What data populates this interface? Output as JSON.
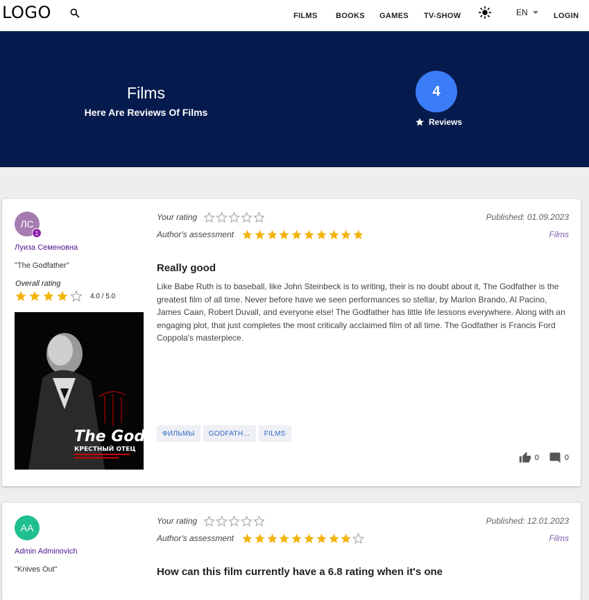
{
  "header": {
    "logo": "LOGO",
    "nav": {
      "films": "FILMS",
      "books": "BOOKS",
      "games": "GAMES",
      "tvshow": "TV-SHOW"
    },
    "language": "EN",
    "login": "LOGIN"
  },
  "hero": {
    "title": "Films",
    "subtitle": "Here Are Reviews Of Films",
    "count": "4",
    "count_label": "Reviews"
  },
  "colors": {
    "hero_bg": "#061b4d",
    "accent": "#3b7cf7",
    "star": "#f5b20a"
  },
  "reviews": [
    {
      "avatar_initials": "ЛС",
      "avatar_color": "#a57cb0",
      "badge": "1",
      "author": "Луиза Семеновна",
      "work": "\"The Godfather\"",
      "overall_label": "Overall rating",
      "overall_value": "4.0 / 5.0",
      "overall_stars": 4,
      "your_rating_label": "Your rating",
      "your_rating": 0,
      "author_assessment_label": "Author's assessment",
      "author_assessment": 10,
      "published": "Published: 01.09.2023",
      "category": "Films",
      "title": "Really good",
      "text": "Like Babe Ruth is to baseball, like John Steinbeck is to writing, their is no doubt about it, The Godfather is the greatest film of all time. Never before have we seen performances so stellar, by Marlon Brando, Al Pacino, James Caan, Robert Duvall, and everyone else! The Godfather has little life lessons everywhere. Along with an engaging plot, that just completes the most critically acclaimed film of all time. The Godfather is Francis Ford Coppola's masterpiece.",
      "tags": [
        "ФИЛЬМЫ",
        "GODFATH…",
        "FILMS"
      ],
      "likes": "0",
      "comments": "0",
      "poster_title": "The Godfather",
      "poster_subtitle": "КРЕСТНЫЙ ОТЕЦ"
    },
    {
      "avatar_initials": "AA",
      "avatar_color": "#1fbf8f",
      "author": "Admin Adminovich",
      "work": "\"Knives Out\"",
      "your_rating_label": "Your rating",
      "your_rating": 0,
      "author_assessment_label": "Author's assessment",
      "author_assessment": 9,
      "published": "Published: 12.01.2023",
      "category": "Films",
      "title": "How can this film currently have a 6.8 rating when it's one"
    }
  ]
}
